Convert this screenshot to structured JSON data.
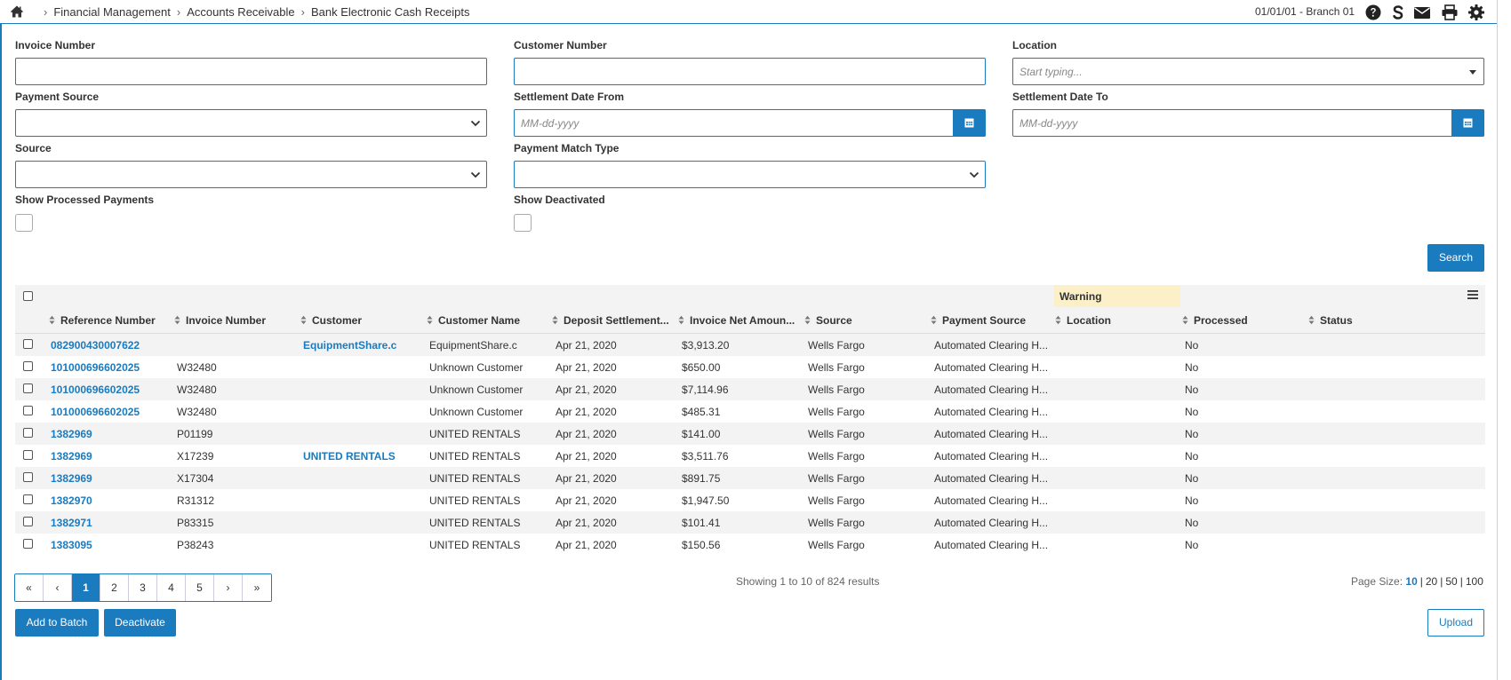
{
  "breadcrumb": [
    "Financial Management",
    "Accounts Receivable",
    "Bank Electronic Cash Receipts"
  ],
  "header": {
    "branch": "01/01/01 - Branch 01"
  },
  "icons": [
    "home-icon",
    "help-icon",
    "dollar-s-icon",
    "mail-icon",
    "print-icon",
    "gear-icon"
  ],
  "filters": {
    "invoice_number": {
      "label": "Invoice Number",
      "value": ""
    },
    "customer_number": {
      "label": "Customer Number",
      "value": ""
    },
    "location": {
      "label": "Location",
      "placeholder": "Start typing..."
    },
    "payment_source": {
      "label": "Payment Source",
      "value": ""
    },
    "settlement_from": {
      "label": "Settlement Date From",
      "placeholder": "MM-dd-yyyy"
    },
    "settlement_to": {
      "label": "Settlement Date To",
      "placeholder": "MM-dd-yyyy"
    },
    "source": {
      "label": "Source",
      "value": ""
    },
    "payment_match_type": {
      "label": "Payment Match Type",
      "value": ""
    },
    "show_processed": {
      "label": "Show Processed Payments",
      "checked": false
    },
    "show_deactivated": {
      "label": "Show Deactivated",
      "checked": false
    }
  },
  "search_label": "Search",
  "grid": {
    "group_header": "Warning",
    "columns": [
      "Reference Number",
      "Invoice Number",
      "Customer",
      "Customer Name",
      "Deposit Settlement...",
      "Invoice Net Amoun...",
      "Source",
      "Payment Source",
      "Location",
      "Processed",
      "Status"
    ],
    "rows": [
      {
        "ref": "082900430007622",
        "invoice": "",
        "customer": "EquipmentShare.c",
        "name": "EquipmentShare.c",
        "date": "Apr 21, 2020",
        "amount": "$3,913.20",
        "source": "Wells Fargo",
        "payment_source": "Automated Clearing H...",
        "location": "",
        "processed": "No",
        "status": ""
      },
      {
        "ref": "101000696602025",
        "invoice": "W32480",
        "customer": "",
        "name": "Unknown Customer",
        "date": "Apr 21, 2020",
        "amount": "$650.00",
        "source": "Wells Fargo",
        "payment_source": "Automated Clearing H...",
        "location": "",
        "processed": "No",
        "status": ""
      },
      {
        "ref": "101000696602025",
        "invoice": "W32480",
        "customer": "",
        "name": "Unknown Customer",
        "date": "Apr 21, 2020",
        "amount": "$7,114.96",
        "source": "Wells Fargo",
        "payment_source": "Automated Clearing H...",
        "location": "",
        "processed": "No",
        "status": ""
      },
      {
        "ref": "101000696602025",
        "invoice": "W32480",
        "customer": "",
        "name": "Unknown Customer",
        "date": "Apr 21, 2020",
        "amount": "$485.31",
        "source": "Wells Fargo",
        "payment_source": "Automated Clearing H...",
        "location": "",
        "processed": "No",
        "status": ""
      },
      {
        "ref": "1382969",
        "invoice": "P01199",
        "customer": "",
        "name": "UNITED RENTALS",
        "date": "Apr 21, 2020",
        "amount": "$141.00",
        "source": "Wells Fargo",
        "payment_source": "Automated Clearing H...",
        "location": "",
        "processed": "No",
        "status": ""
      },
      {
        "ref": "1382969",
        "invoice": "X17239",
        "customer": "UNITED RENTALS",
        "name": "UNITED RENTALS",
        "date": "Apr 21, 2020",
        "amount": "$3,511.76",
        "source": "Wells Fargo",
        "payment_source": "Automated Clearing H...",
        "location": "",
        "processed": "No",
        "status": ""
      },
      {
        "ref": "1382969",
        "invoice": "X17304",
        "customer": "",
        "name": "UNITED RENTALS",
        "date": "Apr 21, 2020",
        "amount": "$891.75",
        "source": "Wells Fargo",
        "payment_source": "Automated Clearing H...",
        "location": "",
        "processed": "No",
        "status": ""
      },
      {
        "ref": "1382970",
        "invoice": "R31312",
        "customer": "",
        "name": "UNITED RENTALS",
        "date": "Apr 21, 2020",
        "amount": "$1,947.50",
        "source": "Wells Fargo",
        "payment_source": "Automated Clearing H...",
        "location": "",
        "processed": "No",
        "status": ""
      },
      {
        "ref": "1382971",
        "invoice": "P83315",
        "customer": "",
        "name": "UNITED RENTALS",
        "date": "Apr 21, 2020",
        "amount": "$101.41",
        "source": "Wells Fargo",
        "payment_source": "Automated Clearing H...",
        "location": "",
        "processed": "No",
        "status": ""
      },
      {
        "ref": "1383095",
        "invoice": "P38243",
        "customer": "",
        "name": "UNITED RENTALS",
        "date": "Apr 21, 2020",
        "amount": "$150.56",
        "source": "Wells Fargo",
        "payment_source": "Automated Clearing H...",
        "location": "",
        "processed": "No",
        "status": ""
      }
    ]
  },
  "pagination": {
    "first": "«",
    "prev": "‹",
    "pages": [
      "1",
      "2",
      "3",
      "4",
      "5"
    ],
    "active": "1",
    "next": "›",
    "last": "»",
    "showing": "Showing 1 to 10 of 824 results",
    "page_size_label": "Page Size:",
    "page_sizes": [
      "10",
      "20",
      "50",
      "100"
    ],
    "page_size_selected": "10"
  },
  "actions": {
    "add_to_batch": "Add to Batch",
    "deactivate": "Deactivate",
    "upload": "Upload"
  },
  "colors": {
    "accent": "#1a7bbf",
    "warning_band": "#fcf0c8",
    "row_alt": "#f3f3f3"
  }
}
